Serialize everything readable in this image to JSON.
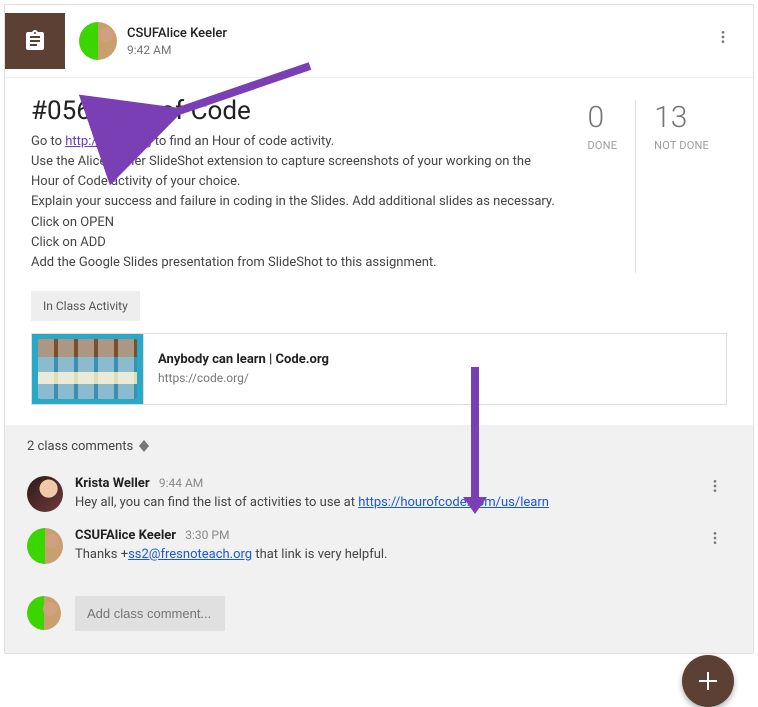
{
  "header": {
    "author": "CSUFAlice Keeler",
    "time": "9:42 AM"
  },
  "post": {
    "title": "#056 Hour of Code",
    "line1_pre": "Go to ",
    "line1_link": "http://code.org",
    "line1_post": " to find an Hour of code activity.",
    "line2": "Use the Alice Keeler SlideShot extension to capture screenshots of your working on the Hour of Code activity of your choice.",
    "line3": "Explain your success and failure in coding in the Slides. Add additional slides as necessary.",
    "line4": "Click on OPEN",
    "line5": "Click on ADD",
    "line6": "Add the Google Slides presentation from SlideShot to this assignment."
  },
  "stats": {
    "done_num": "0",
    "done_label": "DONE",
    "notdone_num": "13",
    "notdone_label": "NOT DONE"
  },
  "chip": "In Class Activity",
  "attachment": {
    "title": "Anybody can learn | Code.org",
    "url": "https://code.org/"
  },
  "comments": {
    "header": "2 class comments",
    "items": [
      {
        "author": "Krista Weller",
        "time": "9:44 AM",
        "text_pre": "Hey all, you can find the list of activities to use at ",
        "link": "https://hourofcode.com/us/learn",
        "text_post": ""
      },
      {
        "author": "CSUFAlice Keeler",
        "time": "3:30 PM",
        "text_pre": "Thanks +",
        "link": "ss2@fresnoteach.org",
        "text_post": " that link is very helpful."
      }
    ],
    "add_placeholder": "Add class comment..."
  }
}
